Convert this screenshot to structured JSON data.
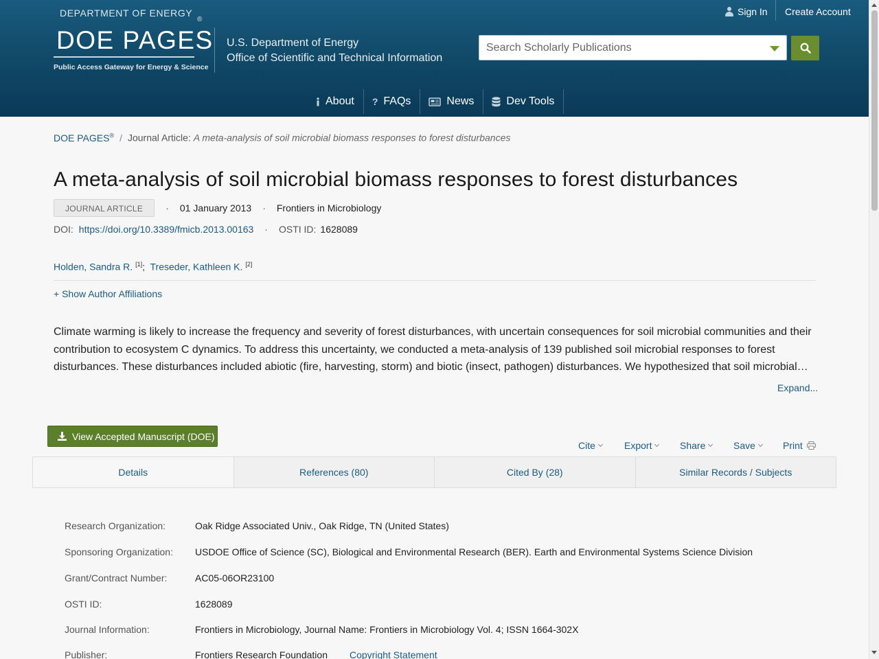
{
  "header": {
    "logo": {
      "department": "DEPARTMENT OF ENERGY",
      "registered": "®",
      "name": "DOE PAGES",
      "tagline": "Public Access Gateway for Energy & Science"
    },
    "agency_line1": "U.S. Department of Energy",
    "agency_line2": "Office of Scientific and Technical Information",
    "sign_in": "Sign In",
    "create_account": "Create Account",
    "search": {
      "placeholder": "Search Scholarly Publications",
      "value": ""
    },
    "nav": [
      {
        "label": "About",
        "icon": "info-icon"
      },
      {
        "label": "FAQs",
        "icon": "question-icon"
      },
      {
        "label": "News",
        "icon": "newspaper-icon"
      },
      {
        "label": "Dev Tools",
        "icon": "database-icon"
      }
    ]
  },
  "breadcrumb": {
    "home": "DOE PAGES",
    "home_sup": "®",
    "separator": "/",
    "current_prefix": "Journal Article:",
    "current_title": "A meta-analysis of soil microbial biomass responses to forest disturbances"
  },
  "article": {
    "title": "A meta-analysis of soil microbial biomass responses to forest disturbances",
    "type": "JOURNAL ARTICLE",
    "date": "01 January 2013",
    "journal": "Frontiers in Microbiology",
    "doi_label": "DOI:",
    "doi": "https://doi.org/10.3389/fmicb.2013.00163",
    "osti_label": "OSTI ID:",
    "osti_id": "1628089",
    "authors": [
      {
        "name": "Holden, Sandra R.",
        "affil": "[1]"
      },
      {
        "name": "Treseder, Kathleen K.",
        "affil": "[2]"
      }
    ],
    "show_affiliations": "+ Show Author Affiliations",
    "abstract": "Climate warming is likely to increase the frequency and severity of forest disturbances, with uncertain consequences for soil microbial communities and their contribution to ecosystem C dynamics. To address this uncertainty, we conducted a meta-analysis of 139 published soil microbial responses to forest disturbances. These disturbances included abiotic (fire, harvesting, storm) and biotic (insect, pathogen) disturbances. We hypothesized that soil microbial…",
    "expand": "Expand..."
  },
  "actions": {
    "manuscript_button": "View Accepted Manuscript (DOE)",
    "cite": "Cite",
    "export": "Export",
    "share": "Share",
    "save": "Save",
    "print": "Print"
  },
  "tabs": [
    "Details",
    "References (80)",
    "Cited By (28)",
    "Similar Records / Subjects"
  ],
  "details": [
    {
      "key": "Research Organization:",
      "value": "Oak Ridge Associated Univ., Oak Ridge, TN (United States)"
    },
    {
      "key": "Sponsoring Organization:",
      "value": "USDOE Office of Science (SC), Biological and Environmental Research (BER). Earth and Environmental Systems Science Division"
    },
    {
      "key": "Grant/Contract Number:",
      "value": "AC05-06OR23100"
    },
    {
      "key": "OSTI ID:",
      "value": "1628089"
    },
    {
      "key": "Journal Information:",
      "value": "Frontiers in Microbiology, Journal Name: Frontiers in Microbiology Vol. 4; ISSN 1664-302X"
    },
    {
      "key": "Publisher:",
      "value": "Frontiers Research Foundation",
      "link": "Copyright Statement"
    }
  ],
  "colors": {
    "header_top": "#195b7e",
    "header_bottom": "#0a3a57",
    "link": "#1b5b82",
    "green_button": "#5b7f2a",
    "search_button": "#6a8e2f"
  }
}
